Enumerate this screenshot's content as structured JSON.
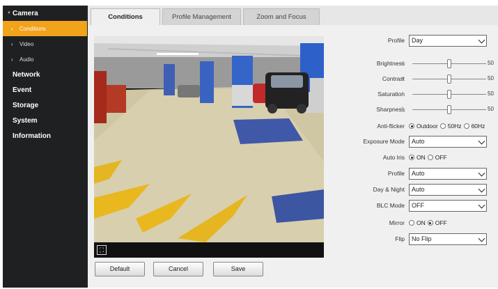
{
  "sidebar": {
    "groups": [
      {
        "label": "Camera",
        "expanded": true
      },
      {
        "label": "Network"
      },
      {
        "label": "Event"
      },
      {
        "label": "Storage"
      },
      {
        "label": "System"
      },
      {
        "label": "Information"
      }
    ],
    "camera_items": [
      {
        "label": "Conditions",
        "active": true
      },
      {
        "label": "Video"
      },
      {
        "label": "Audio"
      }
    ]
  },
  "tabs": [
    {
      "label": "Conditions",
      "active": true
    },
    {
      "label": "Profile Management"
    },
    {
      "label": "Zoom and Focus"
    }
  ],
  "video": {
    "fullscreen_icon": "fullscreen-icon"
  },
  "buttons": {
    "default": "Default",
    "cancel": "Cancel",
    "save": "Save"
  },
  "settings": {
    "profile": {
      "label": "Profile",
      "value": "Day"
    },
    "brightness": {
      "label": "Brightness",
      "value": "50",
      "level": 0.5
    },
    "contrast": {
      "label": "Contrast",
      "value": "50",
      "level": 0.5
    },
    "saturation": {
      "label": "Saturation",
      "value": "50",
      "level": 0.5
    },
    "sharpness": {
      "label": "Sharpness",
      "value": "50",
      "level": 0.5
    },
    "anti_flicker": {
      "label": "Anti-flicker",
      "options": [
        "Outdoor",
        "50Hz",
        "60Hz"
      ],
      "selected": "Outdoor"
    },
    "exposure_mode": {
      "label": "Exposure Mode",
      "value": "Auto"
    },
    "auto_iris": {
      "label": "Auto Iris",
      "options": [
        "ON",
        "OFF"
      ],
      "selected": "ON"
    },
    "iris_profile": {
      "label": "Profile",
      "value": "Auto"
    },
    "day_night": {
      "label": "Day & Night",
      "value": "Auto"
    },
    "blc_mode": {
      "label": "BLC Mode",
      "value": "OFF"
    },
    "mirror": {
      "label": "Mirror",
      "options": [
        "ON",
        "OFF"
      ],
      "selected": "OFF"
    },
    "flip": {
      "label": "Flip",
      "value": "No Flip"
    }
  },
  "colors": {
    "accent": "#f2a31c",
    "sidebar_bg": "#1f2022",
    "content_bg": "#e7e7e7"
  }
}
